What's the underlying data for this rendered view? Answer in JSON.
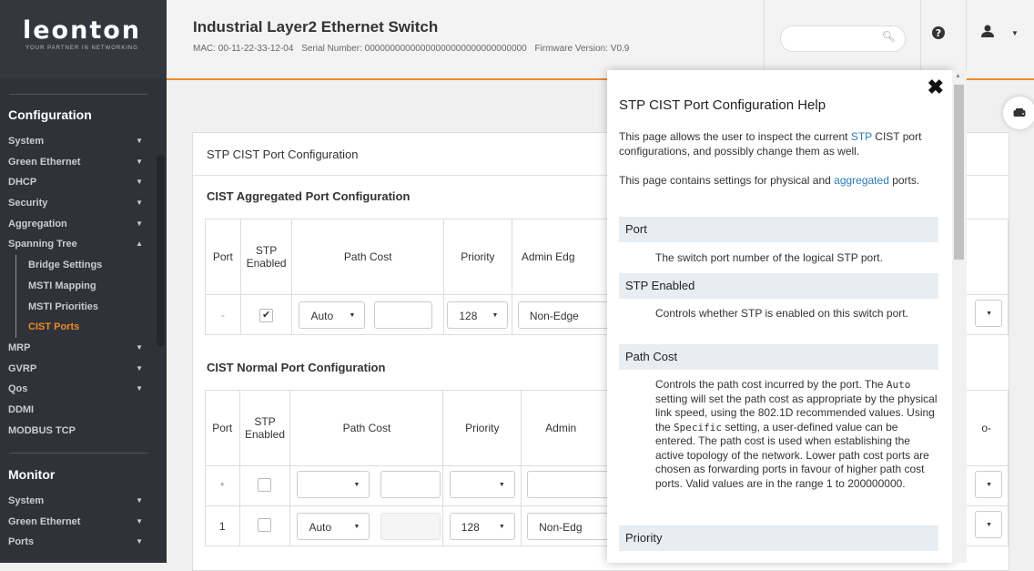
{
  "logo": {
    "brand": "leonton",
    "tagline": "YOUR PARTNER IN NETWORKING"
  },
  "header": {
    "title": "Industrial Layer2 Ethernet Switch",
    "mac": "MAC: 00-11-22-33-12-04",
    "serial": "Serial Number: 00000000000000000000000000000000",
    "firmware": "Firmware Version: V0.9"
  },
  "sidebar": {
    "config_heading": "Configuration",
    "config_items": [
      {
        "label": "System",
        "caret": "▼"
      },
      {
        "label": "Green Ethernet",
        "caret": "▼"
      },
      {
        "label": "DHCP",
        "caret": "▼"
      },
      {
        "label": "Security",
        "caret": "▼"
      },
      {
        "label": "Aggregation",
        "caret": "▼"
      },
      {
        "label": "Spanning Tree",
        "caret": "▲"
      },
      {
        "label": "Bridge Settings"
      },
      {
        "label": "MSTI Mapping"
      },
      {
        "label": "MSTI Priorities"
      },
      {
        "label": "CIST Ports"
      },
      {
        "label": "MRP",
        "caret": "▼"
      },
      {
        "label": "GVRP",
        "caret": "▼"
      },
      {
        "label": "Qos",
        "caret": "▼"
      },
      {
        "label": "DDMI"
      },
      {
        "label": "MODBUS TCP"
      }
    ],
    "monitor_heading": "Monitor",
    "monitor_items": [
      {
        "label": "System",
        "caret": "▼"
      },
      {
        "label": "Green Ethernet",
        "caret": "▼"
      },
      {
        "label": "Ports",
        "caret": "▼"
      }
    ]
  },
  "panel": {
    "title": "STP CIST Port Configuration",
    "agg_title": "CIST Aggregated Port Configuration",
    "normal_title": "CIST Normal Port Configuration",
    "col_port": "Port",
    "col_stp": "STP Enabled",
    "col_path_cost": "Path Cost",
    "col_priority": "Priority",
    "col_admin_edge_a": "Admin Edg",
    "col_admin_edge_b": "Admin",
    "agg_row": {
      "port": "-",
      "stp": "✔",
      "path_cost": "Auto",
      "priority": "128",
      "admin_edge": "Non-Edge"
    },
    "star_row": {
      "port": "*"
    },
    "row1": {
      "port": "1",
      "path_cost": "Auto",
      "priority": "128",
      "admin_edge": "Non-Edg"
    },
    "edge_fragment": "o-"
  },
  "help": {
    "title": "STP CIST Port Configuration Help",
    "intro1_a": "This page allows the user to inspect the current ",
    "intro1_link": "STP",
    "intro1_b": " CIST port configurations, and possibly change them as well.",
    "intro2_a": "This page contains settings for physical and ",
    "intro2_link": "aggregated",
    "intro2_b": " ports.",
    "sections": [
      {
        "title": "Port",
        "desc": "The switch port number of the logical STP port."
      },
      {
        "title": "STP Enabled",
        "desc": "Controls whether STP is enabled on this switch port."
      },
      {
        "title": "Path Cost"
      },
      {
        "title": "Priority"
      }
    ],
    "path_cost_desc_1": "Controls the path cost incurred by the port. The ",
    "path_cost_code_1": "Auto",
    "path_cost_desc_2": " setting will set the path cost as appropriate by the physical link speed, using the 802.1D recommended values. Using the ",
    "path_cost_code_2": "Specific",
    "path_cost_desc_3": " setting, a user-defined value can be entered. The path cost is used when establishing the active topology of the network. Lower path cost ports are chosen as forwarding ports in favour of higher path cost ports. Valid values are in the range 1 to 200000000."
  }
}
